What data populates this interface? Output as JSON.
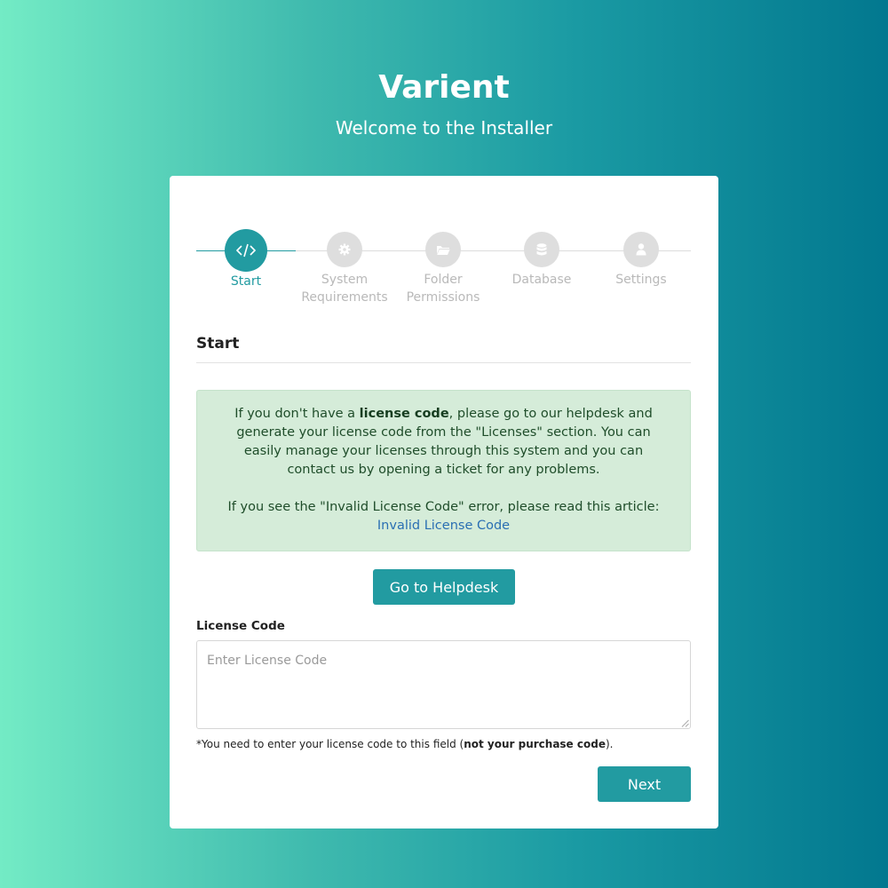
{
  "header": {
    "title": "Varient",
    "subtitle": "Welcome to the Installer"
  },
  "steps": [
    {
      "label_line1": "Start",
      "label_line2": "",
      "icon": "code-icon",
      "active": true
    },
    {
      "label_line1": "System",
      "label_line2": "Requirements",
      "icon": "gear-icon",
      "active": false
    },
    {
      "label_line1": "Folder",
      "label_line2": "Permissions",
      "icon": "folder-open-icon",
      "active": false
    },
    {
      "label_line1": "Database",
      "label_line2": "",
      "icon": "database-icon",
      "active": false
    },
    {
      "label_line1": "Settings",
      "label_line2": "",
      "icon": "user-icon",
      "active": false
    }
  ],
  "section": {
    "title": "Start"
  },
  "alert": {
    "p1_before": "If you don't have a ",
    "p1_bold": "license code",
    "p1_after": ", please go to our helpdesk and generate your license code from the \"Licenses\" section. You can easily manage your licenses through this system and you can contact us by opening a ticket for any problems.",
    "p2_before": "If you see the \"Invalid License Code\" error, please read this article: ",
    "p2_link": "Invalid License Code"
  },
  "buttons": {
    "helpdesk": "Go to Helpdesk",
    "next": "Next"
  },
  "license": {
    "label": "License Code",
    "placeholder": "Enter License Code",
    "value": ""
  },
  "note": {
    "before": "*You need to enter your license code to this field (",
    "bold": "not your purchase code",
    "after": ")."
  },
  "colors": {
    "accent": "#229ba1",
    "gradient_start": "#73ebc5",
    "gradient_end": "#02788f",
    "alert_bg": "#d5ecd9",
    "link": "#2a6fb3"
  }
}
